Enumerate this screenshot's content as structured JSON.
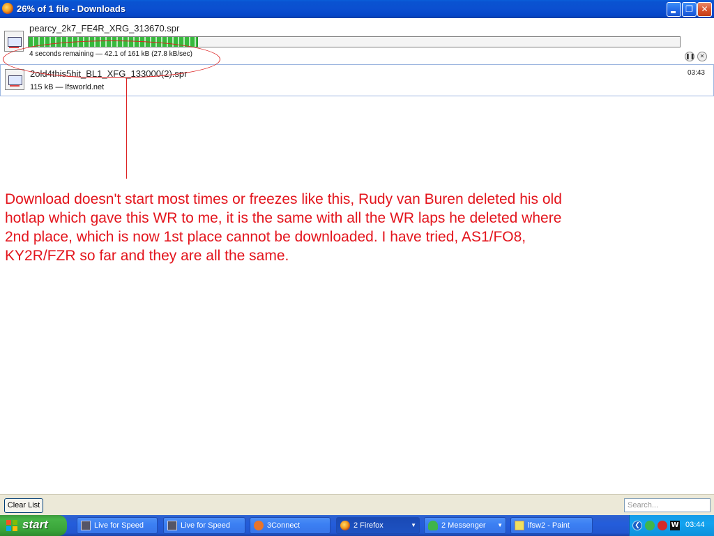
{
  "window": {
    "title": "26% of 1 file - Downloads",
    "minimize_icon": "minimize-icon",
    "maximize_icon": "restore-icon",
    "close_icon": "close-icon"
  },
  "downloads": [
    {
      "filename": "pearcy_2k7_FE4R_XRG_313670.spr",
      "status": "4 seconds remaining — 42.1 of 161 kB (27.8 kB/sec)",
      "progress_fraction": 0.26,
      "state": "in-progress"
    },
    {
      "filename": "2old4this5hit_BL1_XFG_133000(2).spr",
      "status": "115 kB — lfsworld.net",
      "time": "03:43",
      "state": "completed"
    }
  ],
  "annotation": {
    "color": "#e3141c",
    "lines": [
      "Download doesn't start most times or freezes like this, Rudy van Buren deleted his old",
      "hotlap which gave this WR to me, it is the same with all the WR laps he deleted where",
      "2nd place, which is now 1st place cannot be downloaded. I have tried, AS1/FO8,",
      "KY2R/FZR so far and they are all the same."
    ]
  },
  "bottom_bar": {
    "clear_list_label": "Clear List",
    "search_placeholder": "Search..."
  },
  "taskbar": {
    "start_label": "start",
    "items": [
      {
        "label": "Live for Speed",
        "icon": "lfs-icon"
      },
      {
        "label": "Live for Speed",
        "icon": "lfs-icon"
      },
      {
        "label": "3Connect",
        "icon": "3connect-icon"
      },
      {
        "label": "2 Firefox",
        "icon": "firefox-icon",
        "active": true
      },
      {
        "label": "2 Messenger",
        "icon": "messenger-icon"
      },
      {
        "label": "lfsw2 - Paint",
        "icon": "paint-icon"
      }
    ],
    "clock": "03:44"
  }
}
